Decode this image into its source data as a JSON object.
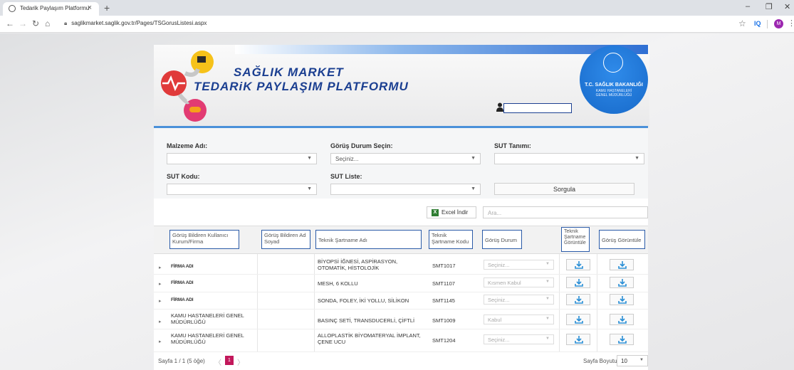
{
  "browser": {
    "tab_title": "Tedarik Paylaşım Platformu",
    "new_tab": "+",
    "url": "saglikmarket.saglik.gov.tr/Pages/TSGorusListesi.aspx",
    "ext_iq": "IQ",
    "avatar_letter": "M"
  },
  "header": {
    "brand_line1": "SAĞLIK MARKET",
    "brand_line2": "TEDARiK PAYLAŞIM PLATFORMU",
    "seal_line1": "T.C. SAĞLIK BAKANLIĞI",
    "seal_line2": "KAMU HASTANELERİ",
    "seal_line3": "GENEL MÜDÜRLÜĞÜ"
  },
  "filters": {
    "malzeme_label": "Malzeme Adı:",
    "malzeme_value": "",
    "gorus_label": "Görüş Durum Seçin:",
    "gorus_value": "Seçiniz...",
    "sut_tanimi_label": "SUT Tanımı:",
    "sut_tanimi_value": "",
    "sut_kodu_label": "SUT Kodu:",
    "sut_kodu_value": "",
    "sut_liste_label": "SUT Liste:",
    "sut_liste_value": "",
    "search_button": "Sorgula"
  },
  "grid": {
    "excel_button": "Excel İndir",
    "search_placeholder": "Ara...",
    "columns": [
      "Görüş Bildiren Kullanıcı Kurum/Firma",
      "Görüş Bildiren Ad Soyad",
      "Teknik Şartname Adı",
      "Teknik Şartname Kodu",
      "Görüş Durum",
      "Teknik Şartname Görüntüle",
      "Görüş Görüntüle"
    ],
    "rows": [
      {
        "kurum": "FİRMA ADI",
        "ad": "",
        "sartname": "BİYOPSİ İĞNESİ, ASPİRASYON, OTOMATİK, HİSTOLOJİK",
        "kod": "SMT1017",
        "durum": "Seçiniz..."
      },
      {
        "kurum": "FİRMA ADI",
        "ad": "",
        "sartname": "MESH, 6 KOLLU",
        "kod": "SMT1107",
        "durum": "Kısmen Kabul"
      },
      {
        "kurum": "FİRMA ADI",
        "ad": "",
        "sartname": "SONDA, FOLEY, İKİ YOLLU, SİLİKON",
        "kod": "SMT1145",
        "durum": "Seçiniz..."
      },
      {
        "kurum": "KAMU HASTANELERİ GENEL MÜDÜRLÜĞÜ",
        "ad": "",
        "sartname": "BASINÇ SETİ, TRANSDUCERLİ, ÇİFTLİ",
        "kod": "SMT1009",
        "durum": "Kabul"
      },
      {
        "kurum": "KAMU HASTANELERİ GENEL MÜDÜRLÜĞÜ",
        "ad": "",
        "sartname": "ALLOPLASTİK BİYOMATERYAL İMPLANT, ÇENE UCU",
        "kod": "SMT1204",
        "durum": "Seçiniz..."
      }
    ]
  },
  "pager": {
    "info": "Sayfa 1 / 1 (5 öğe)",
    "current_page": "1",
    "page_size_label": "Sayfa Boyutu:",
    "page_size": "10"
  },
  "colors": {
    "brand_blue": "#1b3f91",
    "accent_blue": "#4a90d9",
    "pager_active": "#c2185b",
    "header_border": "#2b5ba8"
  }
}
